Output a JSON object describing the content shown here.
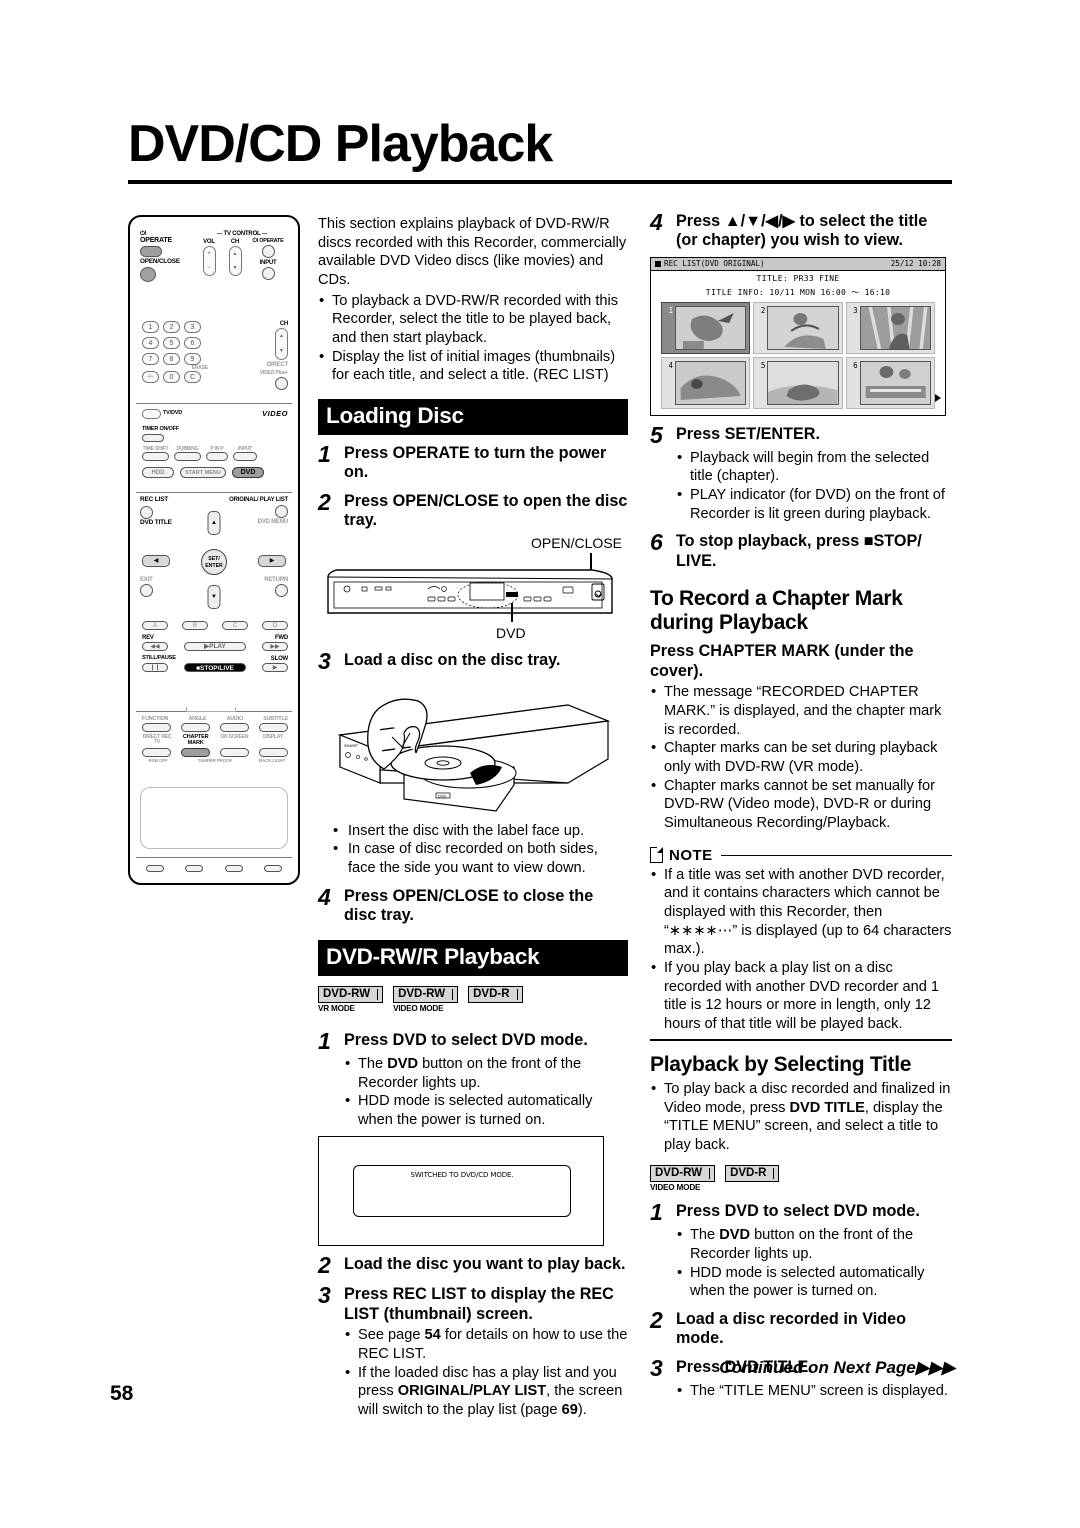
{
  "page": {
    "title": "DVD/CD Playback",
    "number": "58",
    "continued": "Continued on Next Page"
  },
  "intro": {
    "paragraph": "This section explains playback of DVD-RW/R discs recorded with this Recorder, commercially available DVD Video discs (like movies) and CDs.",
    "bullets": [
      "To playback a DVD-RW/R recorded with this Recorder, select the title to be played back, and then start playback.",
      "Display the list of initial images (thumbnails) for each title, and select a title. (REC LIST)"
    ]
  },
  "loading_disc": {
    "banner": "Loading Disc",
    "steps": [
      {
        "num": "1",
        "text_html": "Press <b>OPERATE</b> to turn the power on."
      },
      {
        "num": "2",
        "text_html": "Press <b>OPEN/CLOSE</b> to open the disc tray."
      },
      {
        "num": "3",
        "text_html": "Load a disc on the disc tray."
      },
      {
        "num": "4",
        "text_html": "Press <b>OPEN/CLOSE</b> to close the disc tray."
      }
    ],
    "callout_open_close": "OPEN/CLOSE",
    "callout_dvd": "DVD",
    "disc_bullets": [
      "Insert the disc with the label face up.",
      "In case of disc recorded on both sides, face the side you want to view down."
    ]
  },
  "dvd_rw_r_playback": {
    "banner": "DVD-RW/R Playback",
    "badges": [
      {
        "label": "DVD-RW",
        "sub": "VR MODE"
      },
      {
        "label": "DVD-RW",
        "sub": "VIDEO MODE"
      },
      {
        "label": "DVD-R",
        "sub": ""
      }
    ],
    "step1": {
      "num": "1",
      "text_html": "Press <b>DVD</b> to select DVD mode."
    },
    "step1_bullets_html": [
      "The <b>DVD</b> button on the front of the Recorder lights up.",
      "HDD mode is selected automatically when the power is turned on."
    ],
    "osd_message": "SWITCHED TO DVD/CD MODE.",
    "step2": {
      "num": "2",
      "text_html": "Load the disc you want to play back."
    },
    "step3": {
      "num": "3",
      "text_html": "Press <b>REC LIST</b> to display the REC LIST (thumbnail) screen."
    },
    "step3_bullets_html": [
      "See page <b>54</b> for details on how to use the REC LIST.",
      "If the loaded disc has a play list and you press <b>ORIGINAL/PLAY LIST</b>, the screen will switch to the play list (page <b>69</b>)."
    ],
    "step4": {
      "num": "4",
      "text_html": "Press ▲/▼/◀/▶ to select the title (or chapter) you wish to view."
    },
    "step5": {
      "num": "5",
      "text_html": "Press <b>SET/ENTER</b>."
    },
    "step5_bullets": [
      "Playback will begin from the selected title (chapter).",
      "PLAY indicator (for DVD) on the front of Recorder is lit green during playback."
    ],
    "step6": {
      "num": "6",
      "text_html": "To stop playback, press ■<b>STOP/ LIVE</b>."
    }
  },
  "rec_list_screen": {
    "header_title": "REC LIST(DVD ORIGINAL)",
    "header_time": "25/12 10:28",
    "title_label": "TITLE:",
    "title_value": "PR33   FINE",
    "info_label": "TITLE INFO:",
    "info_value": "10/11 MON 16:00  ～  16:10",
    "thumbnails": [
      "1",
      "2",
      "3",
      "4",
      "5",
      "6"
    ],
    "selected_index": 0,
    "next_page_arrow": "right-triangle"
  },
  "chapter_mark": {
    "heading": "To Record a Chapter Mark during Playback",
    "instruction_html": "Press <b>CHAPTER MARK</b> (under the cover).",
    "bullets": [
      "The message “RECORDED CHAPTER MARK.” is displayed, and the chapter mark is recorded.",
      "Chapter marks can be set during playback only with DVD-RW (VR mode).",
      "Chapter marks cannot be set manually for DVD-RW (Video mode), DVD-R or during Simultaneous Recording/Playback."
    ]
  },
  "note": {
    "label": "NOTE",
    "bullets": [
      "If a title was set with another DVD recorder, and it contains characters which cannot be displayed with this Recorder, then “∗∗∗∗⋯” is displayed (up to 64 characters max.).",
      "If you play back a play list on a disc recorded with another DVD recorder and 1 title is 12 hours or more in length, only 12 hours of that title will be played back."
    ]
  },
  "playback_selecting_title": {
    "heading": "Playback by Selecting Title",
    "intro_bullet_html": "To play back a disc recorded and finalized in Video mode, press <b>DVD TITLE</b>, display the “TITLE MENU” screen, and select a title to play back.",
    "badges": [
      {
        "label": "DVD-RW",
        "sub": "VIDEO MODE"
      },
      {
        "label": "DVD-R",
        "sub": ""
      }
    ],
    "step1": {
      "num": "1",
      "text_html": "Press <b>DVD</b> to select DVD mode."
    },
    "step1_bullets_html": [
      "The <b>DVD</b> button on the front of the Recorder lights up.",
      "HDD mode is selected automatically when the power is turned on."
    ],
    "step2": {
      "num": "2",
      "text_html": "Load a disc recorded in Video mode."
    },
    "step3": {
      "num": "3",
      "text_html": "Press <b>DVD TITLE</b>."
    },
    "step3_bullets": [
      "The “TITLE MENU” screen is displayed."
    ]
  },
  "remote": {
    "labels": {
      "operate": "OPERATE",
      "open_close": "OPEN/CLOSE",
      "tv_control": "TV CONTROL",
      "vol": "VOL",
      "ch": "CH",
      "tv_operate": "OPERATE",
      "input": "INPUT",
      "ch2": "CH",
      "direct": "DIRECT",
      "erase": "ERASE",
      "video_plus": "VIDEO Plus+",
      "tv_dvd": "TV/DVD",
      "videoplus_logo": "VIDEO",
      "timer_on_off": "TIMER ON/OFF",
      "time_shift": "TIME SHIFT",
      "dubbing": "DUBBING",
      "p_in_p": "P IN P",
      "input2": "INPUT",
      "hdd": "HDD",
      "start_menu": "START MENU",
      "dvd": "DVD",
      "rec_list": "REC LIST",
      "dvd_title": "DVD TITLE",
      "original_play_list": "ORIGINAL/ PLAY LIST",
      "dvd_menu": "DVD MENU",
      "set_enter": "SET/ ENTER",
      "exit": "EXIT",
      "return": "RETURN",
      "a": "A",
      "b": "B",
      "c": "C",
      "d": "D",
      "rev": "REV",
      "fwd": "FWD",
      "play": "PLAY",
      "still_pause": "STILL/PAUSE",
      "slow": "SLOW",
      "stop_live": "STOP/LIVE",
      "function": "FUNCTION",
      "angle": "ANGLE",
      "audio": "AUDIO",
      "subtitle": "SUBTITLE",
      "direct_rec_tv": "DIRECT REC TV",
      "chapter_mark": "CHAPTER MARK",
      "on_screen": "ON SCREEN",
      "display": "DISPLAY",
      "rgb_off": "RGB OFF",
      "tamper_proof": "TAMPER PROOF",
      "back_light": "BACK LIGHT"
    },
    "numbers": [
      "1",
      "2",
      "3",
      "4",
      "5",
      "6",
      "7",
      "8",
      "9",
      "-/--",
      "0",
      "C"
    ]
  }
}
